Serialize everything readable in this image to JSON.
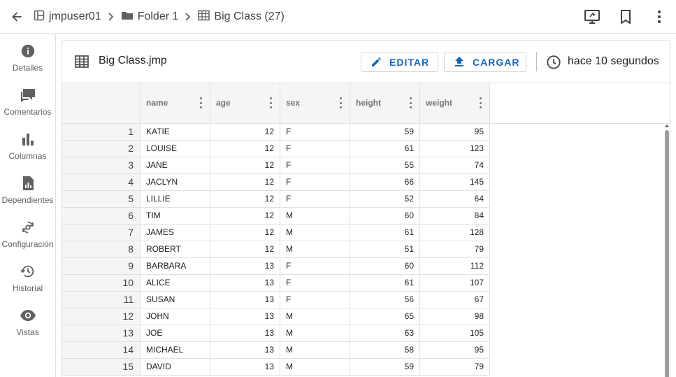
{
  "topbar": {
    "breadcrumb": [
      {
        "label": "jmpuser01",
        "icon": "home-grid-icon"
      },
      {
        "label": "Folder 1",
        "icon": "folder-icon"
      },
      {
        "label": "Big Class (27)",
        "icon": "table-icon"
      }
    ],
    "actions": [
      "present-icon",
      "bookmark-icon",
      "more-vert-icon"
    ]
  },
  "rail": {
    "items": [
      {
        "label": "Detalles",
        "icon": "info-icon"
      },
      {
        "label": "Comentarios",
        "icon": "comments-icon"
      },
      {
        "label": "Columnas",
        "icon": "bar-chart-icon"
      },
      {
        "label": "Dependientes",
        "icon": "report-icon"
      },
      {
        "label": "Configuración",
        "icon": "settings-sync-icon"
      },
      {
        "label": "Historial",
        "icon": "history-icon"
      },
      {
        "label": "Vistas",
        "icon": "eye-icon"
      }
    ]
  },
  "file": {
    "title": "Big Class.jmp",
    "edit_label": "EDITAR",
    "load_label": "CARGAR",
    "timestamp": "hace 10 segundos"
  },
  "colors": {
    "accent": "#1565c0",
    "border": "#e0e0e0",
    "header_bg": "#f5f5f5"
  },
  "table": {
    "columns": [
      "name",
      "age",
      "sex",
      "height",
      "weight"
    ],
    "rows": [
      [
        "1",
        "KATIE",
        "12",
        "F",
        "59",
        "95"
      ],
      [
        "2",
        "LOUISE",
        "12",
        "F",
        "61",
        "123"
      ],
      [
        "3",
        "JANE",
        "12",
        "F",
        "55",
        "74"
      ],
      [
        "4",
        "JACLYN",
        "12",
        "F",
        "66",
        "145"
      ],
      [
        "5",
        "LILLIE",
        "12",
        "F",
        "52",
        "64"
      ],
      [
        "6",
        "TIM",
        "12",
        "M",
        "60",
        "84"
      ],
      [
        "7",
        "JAMES",
        "12",
        "M",
        "61",
        "128"
      ],
      [
        "8",
        "ROBERT",
        "12",
        "M",
        "51",
        "79"
      ],
      [
        "9",
        "BARBARA",
        "13",
        "F",
        "60",
        "112"
      ],
      [
        "10",
        "ALICE",
        "13",
        "F",
        "61",
        "107"
      ],
      [
        "11",
        "SUSAN",
        "13",
        "F",
        "56",
        "67"
      ],
      [
        "12",
        "JOHN",
        "13",
        "M",
        "65",
        "98"
      ],
      [
        "13",
        "JOE",
        "13",
        "M",
        "63",
        "105"
      ],
      [
        "14",
        "MICHAEL",
        "13",
        "M",
        "58",
        "95"
      ],
      [
        "15",
        "DAVID",
        "13",
        "M",
        "59",
        "79"
      ]
    ]
  }
}
